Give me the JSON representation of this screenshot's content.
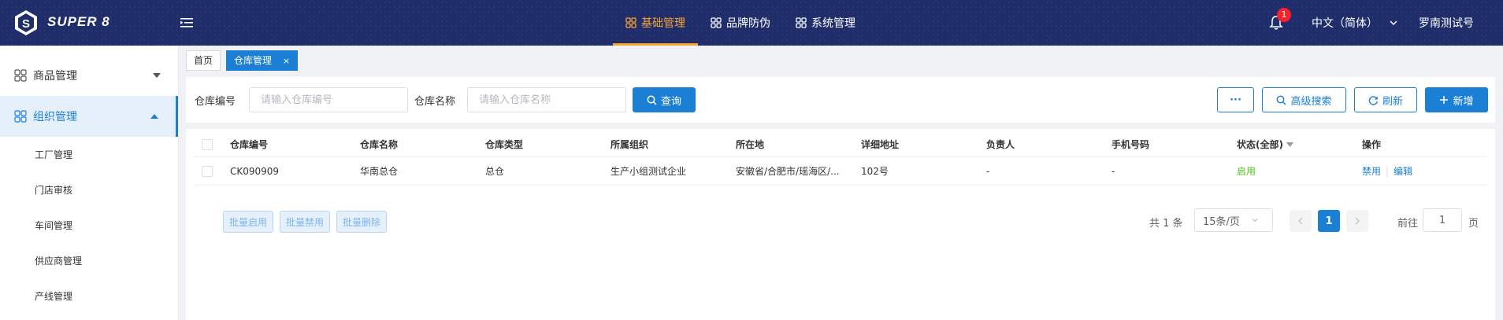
{
  "header": {
    "brand": "SUPER 8",
    "nav": [
      {
        "label": "基础管理",
        "active": true
      },
      {
        "label": "品牌防伪",
        "active": false
      },
      {
        "label": "系统管理",
        "active": false
      }
    ],
    "notification_count": "1",
    "language": "中文（简体）",
    "user": "罗南测试号"
  },
  "sidebar": {
    "groups": [
      {
        "label": "商品管理",
        "expanded": false
      },
      {
        "label": "组织管理",
        "expanded": true
      }
    ],
    "sub_items": [
      "工厂管理",
      "门店审核",
      "车间管理",
      "供应商管理",
      "产线管理"
    ]
  },
  "tabs": [
    {
      "label": "首页",
      "active": false
    },
    {
      "label": "仓库管理",
      "active": true,
      "close": "×"
    }
  ],
  "filter": {
    "code_label": "仓库编号",
    "code_placeholder": "请输入仓库编号",
    "name_label": "仓库名称",
    "name_placeholder": "请输入仓库名称",
    "query_label": "查询",
    "more_label": "···",
    "advanced_label": "高级搜索",
    "refresh_label": "刷新",
    "add_label": "新增"
  },
  "table": {
    "headers": [
      "仓库编号",
      "仓库名称",
      "仓库类型",
      "所属组织",
      "所在地",
      "详细地址",
      "负责人",
      "手机号码",
      "状态(全部)",
      "操作"
    ],
    "rows": [
      {
        "code": "CK090909",
        "name": "华南总仓",
        "type": "总仓",
        "org": "生产小组测试企业",
        "location": "安徽省/合肥市/瑶海区/...",
        "address": "102号",
        "owner": "-",
        "phone": "-",
        "status": "启用",
        "action_disable": "禁用",
        "action_edit": "编辑"
      }
    ]
  },
  "bulk": {
    "enable": "批量启用",
    "disable": "批量禁用",
    "delete": "批量删除"
  },
  "pagination": {
    "total": "共 1 条",
    "page_size": "15条/页",
    "current": "1",
    "goto_prefix": "前往",
    "goto_value": "1",
    "goto_suffix": "页"
  },
  "colors": {
    "header_bg": "#1f2d6b",
    "accent_orange": "#f7a531",
    "primary_blue": "#1c7fd6",
    "status_green": "#52c41a",
    "badge_red": "#f5222d"
  }
}
